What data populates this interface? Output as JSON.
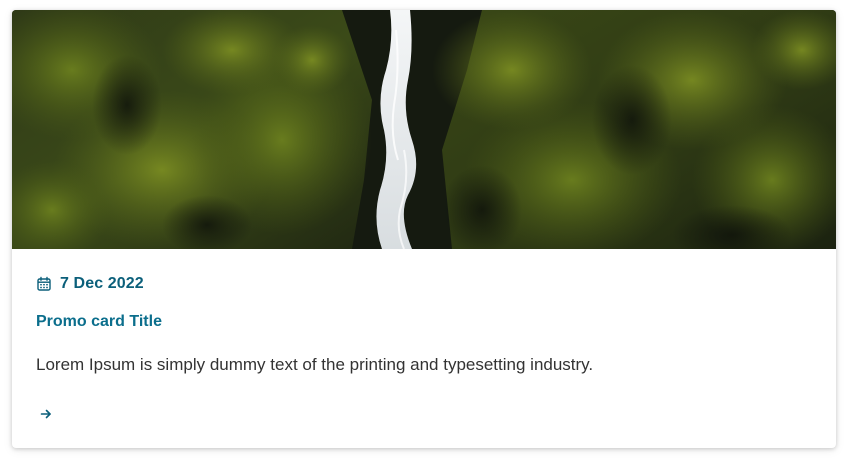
{
  "card": {
    "image": {
      "description_icon": "waterfall-landscape-image"
    },
    "date": {
      "icon": "calendar-icon",
      "text": "7 Dec 2022"
    },
    "title": "Promo card Title",
    "description": "Lorem Ipsum is simply dummy text of the printing and typesetting industry.",
    "link": {
      "icon": "arrow-right-icon"
    }
  },
  "colors": {
    "accent": "#0b5f7a",
    "title": "#0b6e8c",
    "body_text": "#333333",
    "card_background": "#ffffff"
  }
}
